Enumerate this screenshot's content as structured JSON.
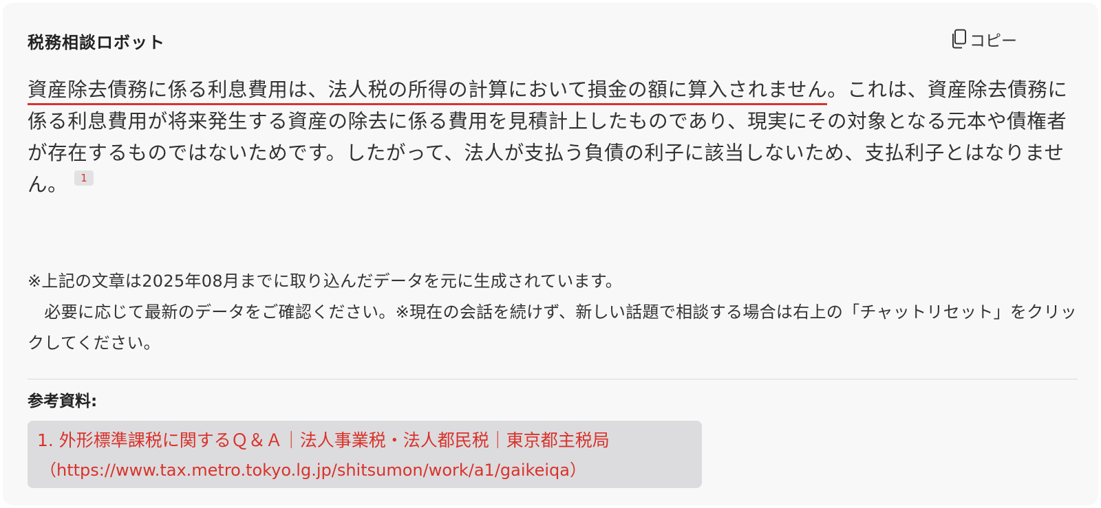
{
  "header": {
    "bot_name": "税務相談ロボット",
    "copy_label": "コピー"
  },
  "answer": {
    "highlighted": "資産除去債務に係る利息費用は、法人税の所得の計算において損金の額に算入されません",
    "rest": "。これは、資産除去債務に係る利息費用が将来発生する資産の除去に係る費用を見積計上したものであり、現実にその対象となる元本や債権者が存在するものではないためです。したがって、法人が支払う負債の利子に該当しないため、支払利子とはなりません。",
    "citation": "1"
  },
  "note": {
    "line1": "※上記の文章は2025年08月までに取り込んだデータを元に生成されています。",
    "line2": "　必要に応じて最新のデータをご確認ください。※現在の会話を続けず、新しい話題で相談する場合は右上の「チャットリセット」をクリックしてください。"
  },
  "references": {
    "title": "参考資料:",
    "items": [
      {
        "label": "1. 外形標準課税に関するＱ＆Ａ｜法人事業税・法人都民税｜東京都主税局",
        "url": "（https://www.tax.metro.tokyo.lg.jp/shitsumon/work/a1/gaikeiqa）"
      }
    ]
  },
  "colors": {
    "accent": "#d9322b",
    "card_background": "#f8f8f9",
    "reference_background": "#dcdcde"
  },
  "icons": {
    "copy": "copy-icon"
  }
}
